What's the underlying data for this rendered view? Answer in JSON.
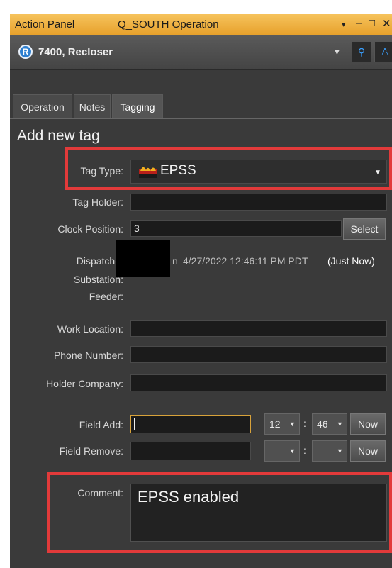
{
  "window": {
    "title": "Action Panel",
    "subtitle": "Q_SOUTH  Operation",
    "controls": [
      "▾",
      "–",
      "□",
      "✕"
    ]
  },
  "device": {
    "badge": "R",
    "name": "7400, Recloser"
  },
  "tabs": [
    {
      "label": "Operation",
      "active": false
    },
    {
      "label": "Notes",
      "active": false
    },
    {
      "label": "Tagging",
      "active": true
    }
  ],
  "section_title": "Add new tag",
  "form": {
    "tag_type": {
      "label": "Tag Type:",
      "value": "EPSS"
    },
    "tag_holder": {
      "label": "Tag Holder:",
      "value": ""
    },
    "clock_position": {
      "label": "Clock Position:",
      "value": "3",
      "button": "Select"
    },
    "dispatcher": {
      "label": "Dispatche",
      "value_suffix": "n",
      "timestamp": "4/27/2022 12:46:11 PM PDT",
      "relative": "(Just Now)"
    },
    "substation": {
      "label": "Substation:"
    },
    "feeder": {
      "label": "Feeder:"
    },
    "work_location": {
      "label": "Work Location:",
      "value": ""
    },
    "phone_number": {
      "label": "Phone Number:",
      "value": ""
    },
    "holder_company": {
      "label": "Holder Company:",
      "value": ""
    },
    "field_add": {
      "label": "Field Add:",
      "value": "",
      "hour": "12",
      "minute": "46",
      "separator": ":",
      "now": "Now"
    },
    "field_remove": {
      "label": "Field Remove:",
      "value": "",
      "hour": "",
      "minute": "",
      "separator": ":",
      "now": "Now"
    },
    "comment": {
      "label": "Comment:",
      "value": "EPSS enabled"
    }
  },
  "colors": {
    "titlebar": "#e7a12c",
    "panel": "#3a3a3a",
    "highlight": "#e23a3a",
    "accent": "#2d7fd0"
  }
}
